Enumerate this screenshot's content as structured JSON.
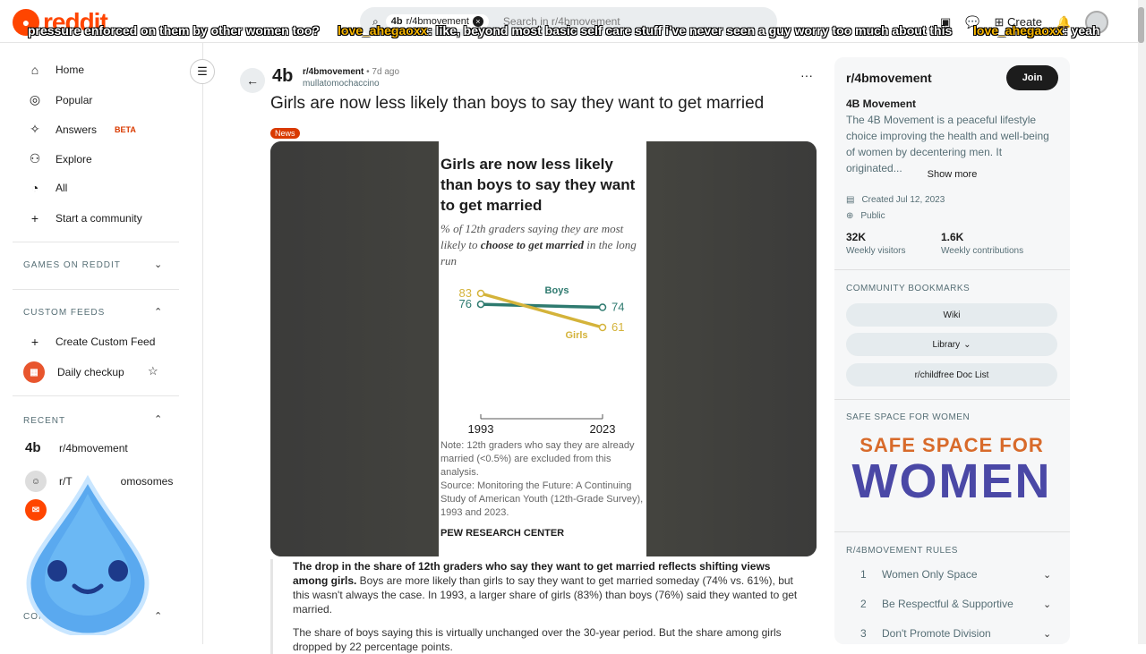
{
  "header": {
    "logo_text": "reddit",
    "search_chip": "r/4bmovement",
    "search_placeholder": "Search in r/4bmovement",
    "create_label": "Create"
  },
  "overlay": {
    "line1": "pressure enforced on them by other women too?",
    "user1": "love_ahegaoxx",
    "msg1": ": like, beyond most basic self care stuff i've never seen a guy worry too much about this",
    "user2": "love_ahegaoxx",
    "msg2": ": yeah"
  },
  "sidebar": {
    "nav": [
      {
        "label": "Home",
        "icon": "home-icon"
      },
      {
        "label": "Popular",
        "icon": "popular-icon"
      },
      {
        "label": "Answers",
        "icon": "answers-icon",
        "badge": "BETA"
      },
      {
        "label": "Explore",
        "icon": "explore-icon"
      },
      {
        "label": "All",
        "icon": "all-icon"
      },
      {
        "label": "Start a community",
        "icon": "plus-icon"
      }
    ],
    "games_title": "GAMES ON REDDIT",
    "custom_feeds_title": "CUSTOM FEEDS",
    "create_feed": "Create Custom Feed",
    "daily_checkup": "Daily checkup",
    "recent_title": "RECENT",
    "recent": [
      "r/4bmovement",
      "r/T",
      "omosomes"
    ],
    "communities_title": "COM"
  },
  "post": {
    "subreddit": "r/4bmovement",
    "time": "7d ago",
    "user": "mullatomochaccino",
    "title": "Girls are now less likely than boys to say they want to get married",
    "flair": "News",
    "chart_title": "Girls are now less likely than boys to say they want to get married",
    "chart_sub_a": "% of 12th graders saying they are ",
    "chart_sub_b": "most likely to ",
    "chart_sub_c": "choose to get married",
    "chart_sub_d": " in the long run",
    "chart_note": "Note: 12th graders who say they are already married (<0.5%) are excluded from this analysis.",
    "chart_source": "Source: Monitoring the Future: A Continuing Study of American Youth (12th-Grade Survey), 1993 and 2023.",
    "chart_org": "PEW RESEARCH CENTER",
    "body_bold": "The drop in the share of 12th graders who say they want to get married reflects shifting views among girls.",
    "body_1": " Boys are more likely than girls to say they want to get married someday (74% vs. 61%), but this wasn't always the case. In 1993, a larger share of girls (83%) than boys (76%) said they wanted to get married.",
    "body_2": "The share of boys saying this is virtually unchanged over the 30-year period. But the share among girls dropped by 22 percentage points."
  },
  "chart_data": {
    "type": "line",
    "x": [
      "1993",
      "2023"
    ],
    "series": [
      {
        "name": "Boys",
        "values": [
          76,
          74
        ],
        "color": "#2e7a6f"
      },
      {
        "name": "Girls",
        "values": [
          83,
          61
        ],
        "color": "#d4b33a"
      }
    ],
    "title": "Girls are now less likely than boys to say they want to get married",
    "ylabel": "% of 12th graders saying they are most likely to choose to get married in the long run"
  },
  "right": {
    "title": "r/4bmovement",
    "join": "Join",
    "name": "4B Movement",
    "desc": "The 4B Movement is a peaceful lifestyle choice improving the health and well-being of women by decentering men. It originated...",
    "show_more": "Show more",
    "created": "Created Jul 12, 2023",
    "visibility": "Public",
    "visitors_num": "32K",
    "visitors_lbl": "Weekly visitors",
    "contrib_num": "1.6K",
    "contrib_lbl": "Weekly contributions",
    "bookmarks_title": "COMMUNITY BOOKMARKS",
    "bookmarks": [
      "Wiki",
      "Library",
      "r/childfree Doc List"
    ],
    "safe_title": "SAFE SPACE FOR WOMEN",
    "banner_1": "SAFE SPACE FOR",
    "banner_2": "WOMEN",
    "rules_title": "R/4BMOVEMENT RULES",
    "rules": [
      {
        "num": "1",
        "text": "Women Only Space"
      },
      {
        "num": "2",
        "text": "Be Respectful & Supportive"
      },
      {
        "num": "3",
        "text": "Don't Promote Division"
      }
    ]
  }
}
